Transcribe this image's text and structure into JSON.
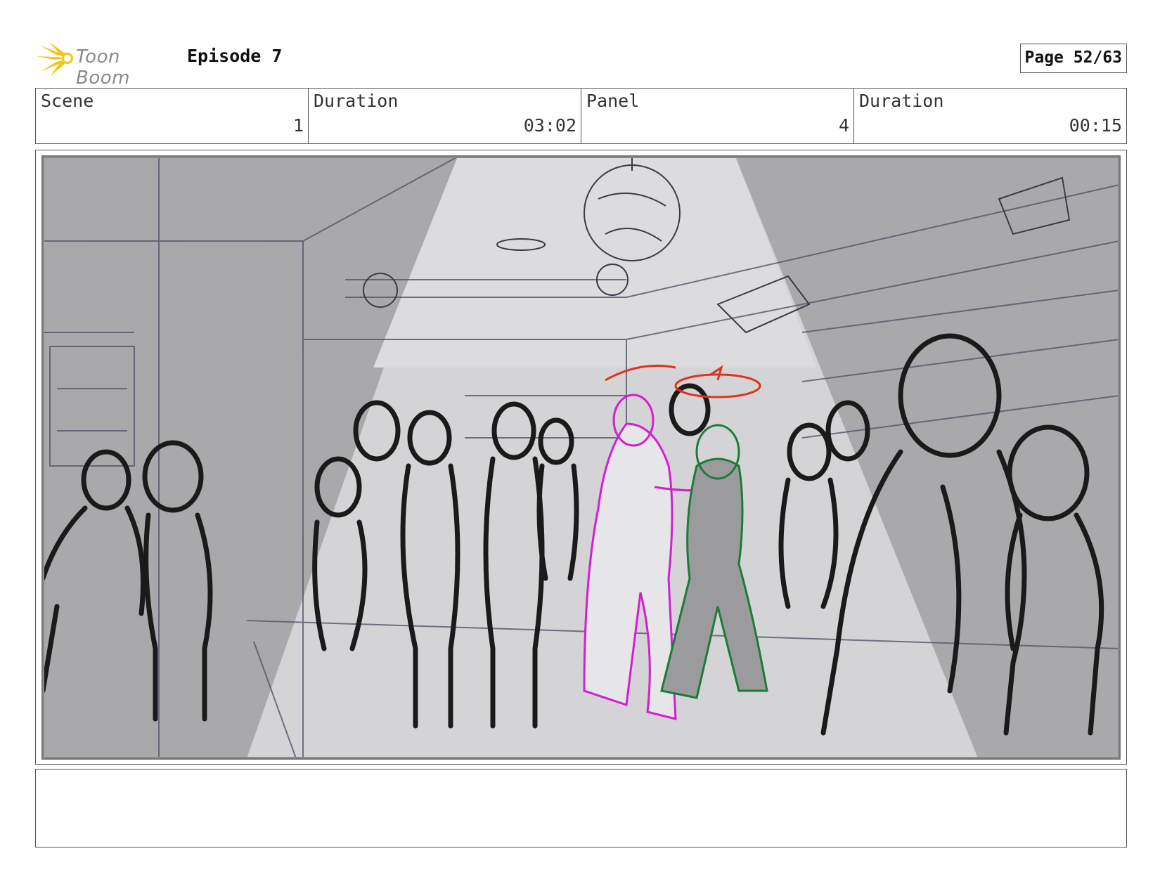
{
  "header": {
    "brand": "Toon Boom",
    "episode": "Episode 7",
    "page": "Page 52/63",
    "brand_color": "#f2c418"
  },
  "info": {
    "scene_label": "Scene",
    "scene_value": "1",
    "scene_duration_label": "Duration",
    "scene_duration_value": "03:02",
    "panel_label": "Panel",
    "panel_value": "4",
    "panel_duration_label": "Duration",
    "panel_duration_value": "00:15"
  },
  "panel": {
    "image": "storyboard-sketch-dance-floor",
    "colors": {
      "sketch": "#1a1a1a",
      "dancer_a": "#d21fd2",
      "dancer_b": "#1c7a3a",
      "annotation": "#e0321c",
      "background": "#a9a9ab",
      "spotlight": "#d4d4d6"
    }
  },
  "notes": {
    "text": ""
  }
}
